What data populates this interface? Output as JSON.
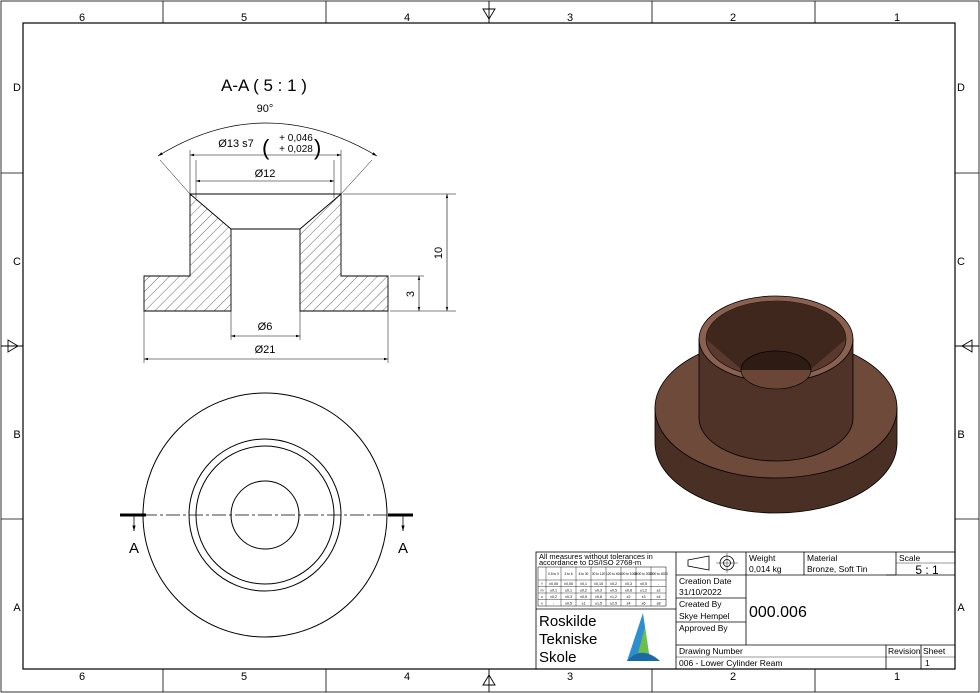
{
  "border": {
    "columns": [
      "6",
      "5",
      "4",
      "3",
      "2",
      "1"
    ],
    "rows": [
      "D",
      "C",
      "B",
      "A"
    ]
  },
  "section_view": {
    "title": "A-A ( 5 : 1 )",
    "angle": "90°",
    "fit_label": "Ø13 s7",
    "tol_upper": "+ 0,046",
    "tol_lower": "+ 0,028",
    "dim_top": "Ø12",
    "dim_bore": "Ø6",
    "dim_base": "Ø21",
    "dim_height": "10",
    "dim_flange": "3"
  },
  "top_view": {
    "cut_label_left": "A",
    "cut_label_right": "A"
  },
  "iso_view": {
    "colors": {
      "dark": "#4a2f24",
      "mid": "#6e4a3b",
      "light": "#8a6150",
      "rim": "#b0907f"
    }
  },
  "tolerance_table": {
    "note_line1": "All measures without tolerances in",
    "note_line2": "accordance to DS/ISO 2768-m",
    "headers": [
      "",
      "0,5 to 3",
      "3 to 6",
      "6 to 30",
      "30 to 120",
      "120 to 400",
      "400 to 1000",
      "1000 to 2000",
      "2000 to 4000"
    ],
    "rows": [
      [
        "f",
        "±0,05",
        "±0,05",
        "±0,1",
        "±0,15",
        "±0,2",
        "±0,3",
        "±0,5",
        "-"
      ],
      [
        "m",
        "±0,1",
        "±0,1",
        "±0,2",
        "±0,3",
        "±0,5",
        "±0,8",
        "±1,2",
        "±2"
      ],
      [
        "c",
        "±0,2",
        "±0,3",
        "±0,5",
        "±0,8",
        "±1,2",
        "±2",
        "±3",
        "±4"
      ],
      [
        "v",
        "-",
        "±0,5",
        "±1",
        "±1,5",
        "±2,5",
        "±4",
        "±6",
        "±8"
      ]
    ]
  },
  "title_block": {
    "weight_label": "Weight",
    "weight_value": "0,014 kg",
    "material_label": "Material",
    "material_value": "Bronze, Soft Tin",
    "scale_label": "Scale",
    "scale_value": "5 : 1",
    "creation_date_label": "Creation Date",
    "creation_date_value": "31/10/2022",
    "created_by_label": "Created By",
    "created_by_value": "Skye Hempel",
    "approved_by_label": "Approved By",
    "part_number": "000.006",
    "school_line1": "Roskilde",
    "school_line2": "Tekniske",
    "school_line3": "Skole",
    "logo_text": "Roskilde Tekniske Skole",
    "drawing_number_label": "Drawing Number",
    "drawing_number_value": "006 - Lower Cylinder Ream",
    "revision_label": "Revision",
    "sheet_label": "Sheet",
    "sheet_value": "1"
  }
}
